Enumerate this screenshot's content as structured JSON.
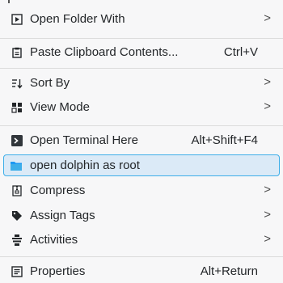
{
  "menu": {
    "items": [
      {
        "label": "Open Folder With",
        "shortcut": "",
        "submenu": ">",
        "icon": "open-with-icon"
      },
      {
        "label": "Paste Clipboard Contents...",
        "shortcut": "Ctrl+V",
        "submenu": "",
        "icon": "paste-icon"
      },
      {
        "label": "Sort By",
        "shortcut": "",
        "submenu": ">",
        "icon": "sort-icon"
      },
      {
        "label": "View Mode",
        "shortcut": "",
        "submenu": ">",
        "icon": "view-mode-icon"
      },
      {
        "label": "Open Terminal Here",
        "shortcut": "Alt+Shift+F4",
        "submenu": "",
        "icon": "terminal-icon"
      },
      {
        "label": "open dolphin as root",
        "shortcut": "",
        "submenu": "",
        "icon": "folder-icon"
      },
      {
        "label": "Compress",
        "shortcut": "",
        "submenu": ">",
        "icon": "compress-icon"
      },
      {
        "label": "Assign Tags",
        "shortcut": "",
        "submenu": ">",
        "icon": "tag-icon"
      },
      {
        "label": "Activities",
        "shortcut": "",
        "submenu": ">",
        "icon": "activities-icon"
      },
      {
        "label": "Properties",
        "shortcut": "Alt+Return",
        "submenu": "",
        "icon": "properties-icon"
      }
    ]
  },
  "colors": {
    "highlight_bg": "#dbeaf7",
    "highlight_border": "#3daee9",
    "folder_blue": "#1d99f3"
  }
}
